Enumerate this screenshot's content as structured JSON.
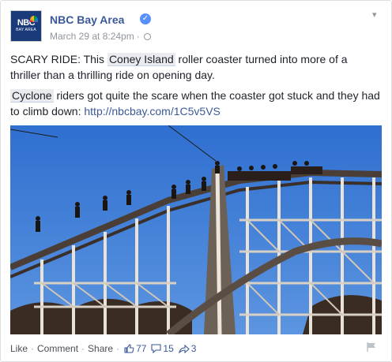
{
  "post": {
    "page_name": "NBC Bay Area",
    "date": "March 29 at 8:24pm",
    "dot": "·",
    "avatar_logo": "NBC",
    "avatar_sub": "BAY AREA",
    "paragraph1": {
      "pre": "SCARY RIDE: This ",
      "tag": "Coney Island",
      "post": " roller coaster turned into more of a thriller than a thrilling ride on opening day."
    },
    "paragraph2": {
      "tag": "Cyclone",
      "post": " riders got quite the scare when the coaster got stuck and they had to climb down: ",
      "link": "http://nbcbay.com/1C5v5VS"
    }
  },
  "footer": {
    "like": "Like",
    "comment": "Comment",
    "share": "Share",
    "dot": "·",
    "likes_count": "77",
    "comments_count": "15",
    "shares_count": "3"
  },
  "colors": {
    "brand_blue": "#3b5998",
    "meta_gray": "#90949c",
    "sky": "#3a7bd5"
  },
  "icons": [
    "verified-badge-icon",
    "globe-icon",
    "chevron-down-icon",
    "thumbs-up-icon",
    "comment-icon",
    "share-arrow-icon",
    "flag-icon"
  ]
}
